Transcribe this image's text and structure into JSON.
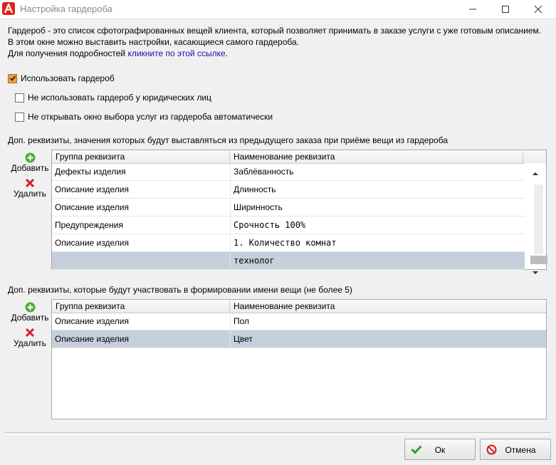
{
  "window": {
    "title": "Настройка гардероба",
    "controls": {
      "minimize": "—",
      "maximize": "☐",
      "close": "✕"
    }
  },
  "intro": {
    "line1": "Гардероб - это список сфотографированных вещей клиента, который позволяет принимать в заказе услуги с уже готовым описанием.",
    "line2": "В этом окне можно выставить настройки, касающиеся самого гардероба.",
    "line3_prefix": "Для получения подробностей ",
    "line3_link": "кликните по этой ссылке",
    "line3_suffix": "."
  },
  "options": [
    {
      "label": "Использовать гардероб",
      "checked": true
    },
    {
      "label": "Не использовать гардероб у юридических лиц",
      "checked": false
    },
    {
      "label": "Не открывать окно выбора услуг из гардероба автоматически",
      "checked": false
    }
  ],
  "section1": {
    "label": "Доп. реквизиты, значения которых будут выставляться из предыдущего заказа при приёме вещи из гардероба",
    "add_label": "Добавить",
    "delete_label": "Удалить",
    "columns": [
      "Группа реквизита",
      "Наименование реквизита"
    ],
    "rows": [
      {
        "group": "Дефекты изделия",
        "name": "Заблёванность",
        "selected": false
      },
      {
        "group": "Описание изделия",
        "name": "Длинность",
        "selected": false
      },
      {
        "group": "Описание изделия",
        "name": "Ширинность",
        "selected": false
      },
      {
        "group": "Предупреждения",
        "name": "Срочность 100%",
        "selected": false
      },
      {
        "group": "Описание изделия",
        "name": "1. Количество комнат",
        "selected": false
      },
      {
        "group": "",
        "name": "технолог",
        "selected": true
      }
    ]
  },
  "section2": {
    "label": "Доп. реквизиты, которые будут участвовать в формировании имени вещи (не более 5)",
    "add_label": "Добавить",
    "delete_label": "Удалить",
    "columns": [
      "Группа реквизита",
      "Наименование реквизита"
    ],
    "rows": [
      {
        "group": "Описание изделия",
        "name": "Пол",
        "selected": false
      },
      {
        "group": "Описание изделия",
        "name": "Цвет",
        "selected": true
      }
    ]
  },
  "buttons": {
    "ok": "Ок",
    "cancel": "Отмена"
  },
  "colors": {
    "accent_red": "#d42020",
    "add_green": "#4caf30",
    "ok_green": "#2e9a2e",
    "selected_row": "#c5d0dc",
    "link": "#1a0dab"
  },
  "icons": {
    "add": "plus-circle-icon",
    "delete": "red-x-icon",
    "ok": "checkmark-icon",
    "cancel": "no-entry-icon"
  }
}
